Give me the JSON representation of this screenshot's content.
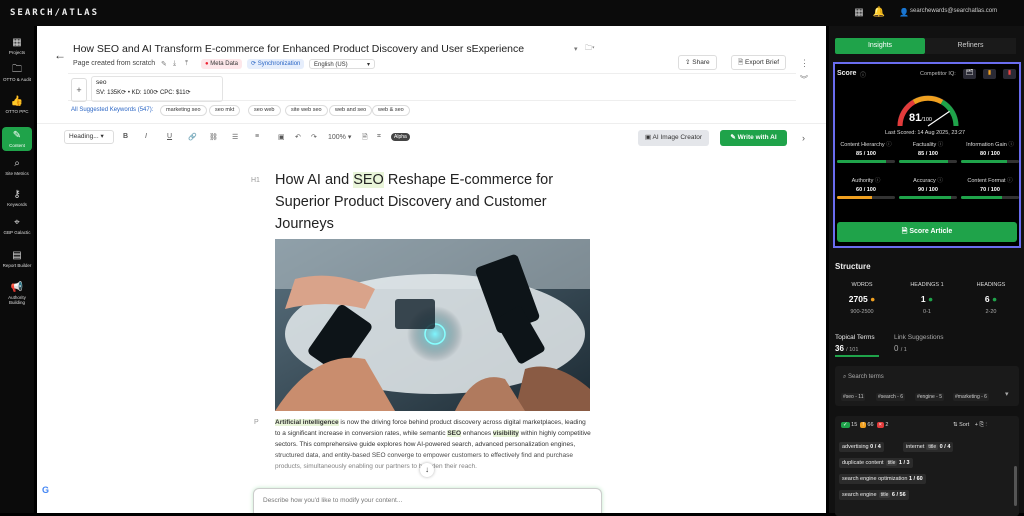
{
  "app": {
    "logo": "SEARCH/ATLAS",
    "user_email": "searchewards@searchatlas.com"
  },
  "nav": [
    {
      "label": "Projects",
      "icon": "grid-icon",
      "glyph": "▦"
    },
    {
      "label": "OTTO & Audit",
      "icon": "folder-icon",
      "glyph": "🗀"
    },
    {
      "label": "OTTO PPC",
      "icon": "thumbs-up-icon",
      "glyph": "👍"
    },
    {
      "label": "Content",
      "icon": "pencil-icon",
      "glyph": "✎"
    },
    {
      "label": "Site Metrics",
      "icon": "search-icon",
      "glyph": "⌕"
    },
    {
      "label": "Keywords",
      "icon": "key-icon",
      "glyph": "⚷"
    },
    {
      "label": "GBP Galactic",
      "icon": "location-icon",
      "glyph": "⌖"
    },
    {
      "label": "Report Builder",
      "icon": "report-icon",
      "glyph": "▤"
    },
    {
      "label": "Authority Building",
      "icon": "megaphone-icon",
      "glyph": "📢"
    }
  ],
  "editor": {
    "title": "How SEO and AI Transform E-commerce for Enhanced Product Discovery and User sExperience",
    "page_created": "Page created from scratch",
    "meta_data": "Meta Data",
    "synchronization": "Synchronization",
    "language": "English (US)",
    "share": "Share",
    "export": "Export Brief",
    "keyword": "seo",
    "keyword_stats": "SV: 135K⟳ • KD: 100⟳  CPC: $11⟳",
    "suggested_label": "All Suggested Keywords (547):",
    "chips": [
      "marketing seo",
      "seo mkt",
      "seo web",
      "site web seo",
      "web and seo",
      "web & seo"
    ],
    "heading_select": "Heading...",
    "zoom": "100%",
    "alpha": "Alpha",
    "ai_image": "AI Image Creator",
    "write_ai": "Write with AI",
    "h1_tag": "H1",
    "h1_part1": "How AI and ",
    "h1_hl": "SEO",
    "h1_part2": " Reshape E-commerce for Superior Product Discovery and Customer Journeys",
    "p_tag": "P",
    "para": {
      "t1": "Artificial intelligence",
      "t2": " is now the driving force behind product discovery across digital marketplaces, leading to a significant increase in conversion rates, while semantic ",
      "t3": "SEO",
      "t4": " enhances ",
      "t5": "visibility",
      "t6": " within highly competitive sectors. This comprehensive guide explores how AI-powered search, advanced personalization engines, structured data, and entity-based SEO converge to empower customers to effectively find and purchase products, simultaneously enabling our partners to broaden their reach."
    },
    "prompt_placeholder": "Describe how you'd like to modify your content..."
  },
  "panel": {
    "tabs": [
      "Insights",
      "Refiners"
    ],
    "score_label": "Score",
    "competitor": "Competitor IQ:",
    "score_value": "81",
    "score_max": "/100",
    "score_fraction": 0.81,
    "last_scored": "Last Scored: 14 Aug 2025, 23:27",
    "metrics": [
      {
        "name": "Content Hierarchy",
        "value": "85 / 100",
        "pct": 85,
        "color": "#1fa34a"
      },
      {
        "name": "Factuality",
        "value": "85 / 100",
        "pct": 85,
        "color": "#1fa34a"
      },
      {
        "name": "Information Gain",
        "value": "80 / 100",
        "pct": 80,
        "color": "#1fa34a"
      },
      {
        "name": "Authority",
        "value": "60 / 100",
        "pct": 60,
        "color": "#f0a020"
      },
      {
        "name": "Accuracy",
        "value": "90 / 100",
        "pct": 90,
        "color": "#1fa34a"
      },
      {
        "name": "Content Format",
        "value": "70 / 100",
        "pct": 70,
        "color": "#1fa34a"
      }
    ],
    "score_button": "Score Article",
    "structure_title": "Structure",
    "structure": [
      {
        "label": "WORDS",
        "value": "2705",
        "range": "900-2500"
      },
      {
        "label": "HEADINGS 1",
        "value": "1",
        "range": "0-1"
      },
      {
        "label": "HEADINGS",
        "value": "6",
        "range": "2-20"
      }
    ],
    "topical_label": "Topical Terms",
    "topical_count": "36",
    "topical_total": "/ 101",
    "link_label": "Link Suggestions",
    "link_count": "0",
    "link_total": "/ 1",
    "search_placeholder": "Search terms",
    "term_tags": [
      "#seo - 11",
      "#search - 6",
      "#engine - 5",
      "#marketing - 6"
    ],
    "filter_counts": [
      "15",
      "66",
      "2"
    ],
    "sort": "Sort",
    "terms": [
      {
        "term": "advertising",
        "count": "0 / 4",
        "badge": ""
      },
      {
        "term": "internet",
        "count": "0 / 4",
        "badge": "title"
      },
      {
        "term": "duplicate content",
        "count": "1 / 3",
        "badge": "title"
      },
      {
        "term": "search engine optimization",
        "count": "1 / 60",
        "badge": ""
      },
      {
        "term": "search engine",
        "count": "6 / 56",
        "badge": "title"
      }
    ]
  }
}
